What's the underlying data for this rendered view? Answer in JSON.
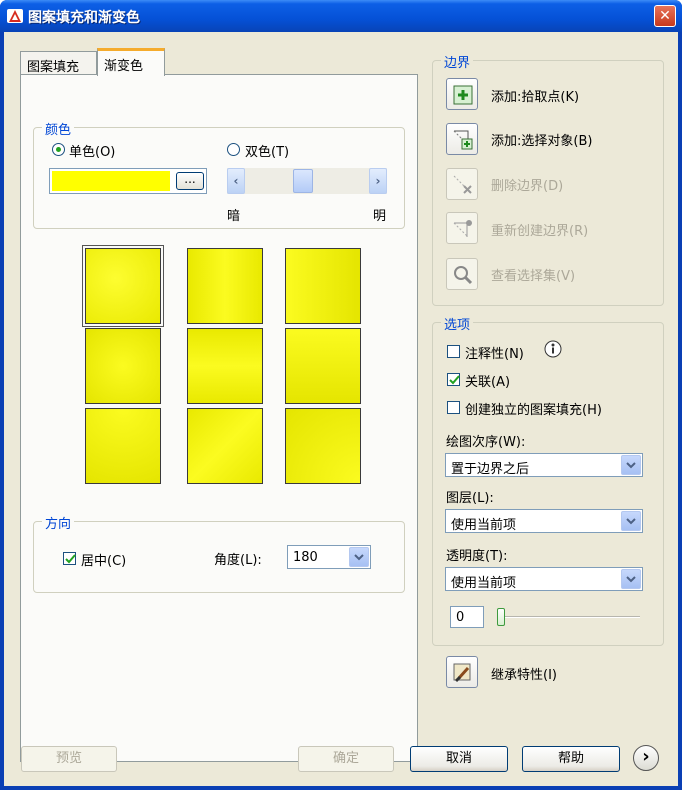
{
  "window": {
    "title": "图案填充和渐变色",
    "close": "✕"
  },
  "tabs": [
    {
      "label": "图案填充"
    },
    {
      "label": "渐变色"
    }
  ],
  "color_group": {
    "legend": "颜色",
    "single_label": "单色(O)",
    "double_label": "双色(T)",
    "selected_mode": "single",
    "color_hex": "#ffff00",
    "browse": "...",
    "dark_label": "暗",
    "light_label": "明",
    "shade_position": 0.5
  },
  "gradient_patterns": {
    "count": 9,
    "selected_index": 0
  },
  "orientation": {
    "legend": "方向",
    "centered_label": "居中(C)",
    "centered_checked": true,
    "angle_label": "角度(L):",
    "angle_value": "180"
  },
  "boundaries": {
    "legend": "边界",
    "add_pick_points": "添加:拾取点(K)",
    "add_select_objects": "添加:选择对象(B)",
    "remove_boundaries": "删除边界(D)",
    "recreate_boundary": "重新创建边界(R)",
    "view_selections": "查看选择集(V)"
  },
  "options": {
    "legend": "选项",
    "annotative_label": "注释性(N)",
    "annotative_checked": false,
    "associative_label": "关联(A)",
    "associative_checked": true,
    "separate_label": "创建独立的图案填充(H)",
    "separate_checked": false,
    "draw_order_label": "绘图次序(W):",
    "draw_order_value": "置于边界之后",
    "layer_label": "图层(L):",
    "layer_value": "使用当前项",
    "transparency_label": "透明度(T):",
    "transparency_value": "使用当前项",
    "transparency_amount": "0"
  },
  "inherit": {
    "label": "继承特性(I)"
  },
  "footer": {
    "preview": "预览",
    "ok": "确定",
    "cancel": "取消",
    "help": "帮助",
    "more": "›"
  },
  "colors": {
    "accent": "#0046d5",
    "gradient": "#ffff00"
  }
}
